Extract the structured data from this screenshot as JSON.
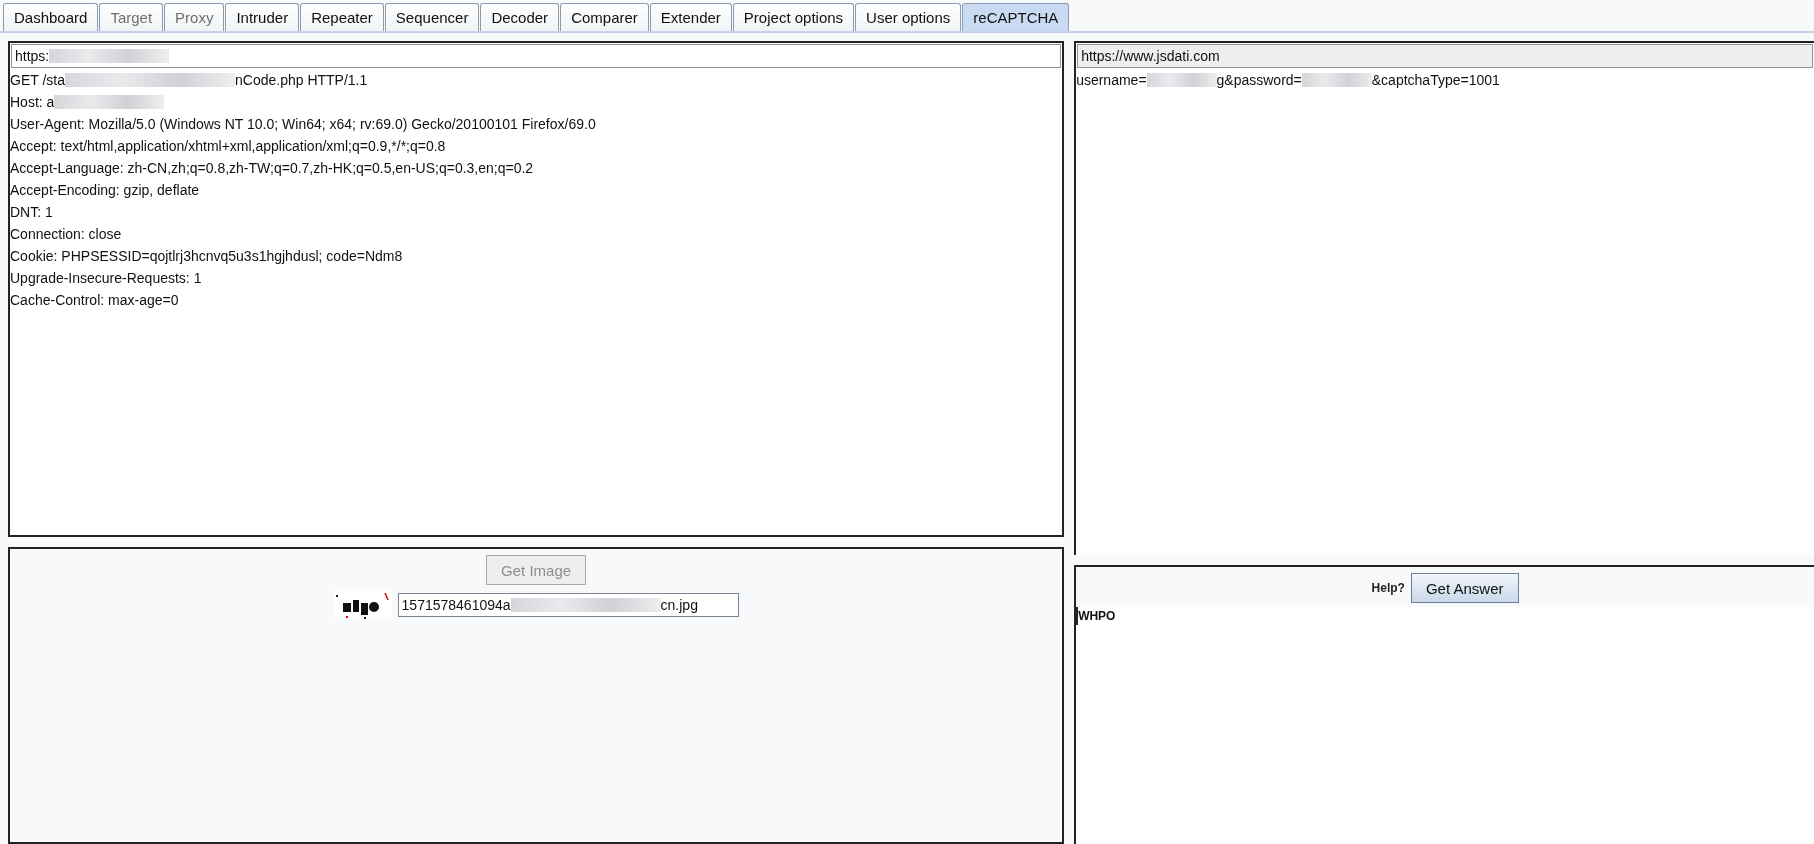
{
  "tabs": [
    {
      "label": "Dashboard",
      "selected": false,
      "dimmed": false
    },
    {
      "label": "Target",
      "selected": false,
      "dimmed": true
    },
    {
      "label": "Proxy",
      "selected": false,
      "dimmed": true
    },
    {
      "label": "Intruder",
      "selected": false,
      "dimmed": false
    },
    {
      "label": "Repeater",
      "selected": false,
      "dimmed": false
    },
    {
      "label": "Sequencer",
      "selected": false,
      "dimmed": false
    },
    {
      "label": "Decoder",
      "selected": false,
      "dimmed": false
    },
    {
      "label": "Comparer",
      "selected": false,
      "dimmed": false
    },
    {
      "label": "Extender",
      "selected": false,
      "dimmed": false
    },
    {
      "label": "Project options",
      "selected": false,
      "dimmed": false
    },
    {
      "label": "User options",
      "selected": false,
      "dimmed": false
    },
    {
      "label": "reCAPTCHA",
      "selected": true,
      "dimmed": false
    }
  ],
  "request_panel": {
    "url": [
      "https:"
    ],
    "lines": [
      [
        "GET /sta",
        "nCode.php HTTP/1.1"
      ],
      [
        "Host: a"
      ],
      [
        "User-Agent: Mozilla/5.0 (Windows NT 10.0; Win64; x64; rv:69.0) Gecko/20100101 Firefox/69.0"
      ],
      [
        "Accept: text/html,application/xhtml+xml,application/xml;q=0.9,*/*;q=0.8"
      ],
      [
        "Accept-Language: zh-CN,zh;q=0.8,zh-TW;q=0.7,zh-HK;q=0.5,en-US;q=0.3,en;q=0.2"
      ],
      [
        "Accept-Encoding: gzip, deflate"
      ],
      [
        "DNT: 1"
      ],
      [
        "Connection: close"
      ],
      [
        "Cookie: PHPSESSID=qojtlrj3hcnvq5u3s1hgjhdusl; code=Ndm8"
      ],
      [
        "Upgrade-Insecure-Requests: 1"
      ],
      [
        "Cache-Control: max-age=0"
      ]
    ]
  },
  "image_panel": {
    "button": {
      "label": "Get Image",
      "disabled": true
    },
    "filename": [
      "1571578461094a",
      "cn.jpg"
    ]
  },
  "service_panel": {
    "url": "https://www.jsdati.com",
    "body": [
      "username=",
      "g&password=",
      "&captchaType=1001"
    ]
  },
  "answer_panel": {
    "help": "Help?",
    "button": {
      "label": "Get Answer",
      "disabled": false
    },
    "answer": "WHPO"
  }
}
